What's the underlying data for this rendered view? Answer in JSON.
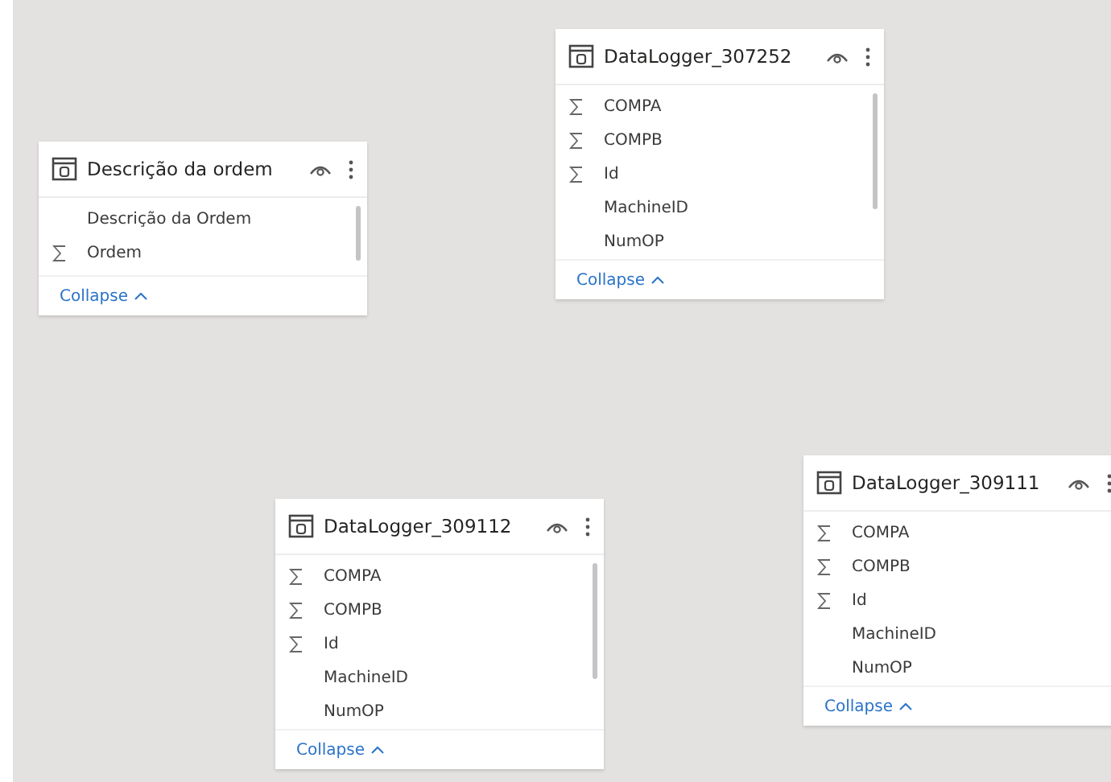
{
  "tables": [
    {
      "title": "Descrição da ordem",
      "fields": [
        {
          "name": "Descrição da Ordem",
          "kind": "column"
        },
        {
          "name": "Ordem",
          "kind": "sum"
        }
      ],
      "collapse": "Collapse"
    },
    {
      "title": "DataLogger_307252",
      "fields": [
        {
          "name": "COMPA",
          "kind": "sum"
        },
        {
          "name": "COMPB",
          "kind": "sum"
        },
        {
          "name": "Id",
          "kind": "sum"
        },
        {
          "name": "MachineID",
          "kind": "column"
        },
        {
          "name": "NumOP",
          "kind": "column"
        }
      ],
      "collapse": "Collapse"
    },
    {
      "title": "DataLogger_309112",
      "fields": [
        {
          "name": "COMPA",
          "kind": "sum"
        },
        {
          "name": "COMPB",
          "kind": "sum"
        },
        {
          "name": "Id",
          "kind": "sum"
        },
        {
          "name": "MachineID",
          "kind": "column"
        },
        {
          "name": "NumOP",
          "kind": "column"
        }
      ],
      "collapse": "Collapse"
    },
    {
      "title": "DataLogger_309111",
      "fields": [
        {
          "name": "COMPA",
          "kind": "sum"
        },
        {
          "name": "COMPB",
          "kind": "sum"
        },
        {
          "name": "Id",
          "kind": "sum"
        },
        {
          "name": "MachineID",
          "kind": "column"
        },
        {
          "name": "NumOP",
          "kind": "column"
        }
      ],
      "collapse": "Collapse"
    }
  ]
}
